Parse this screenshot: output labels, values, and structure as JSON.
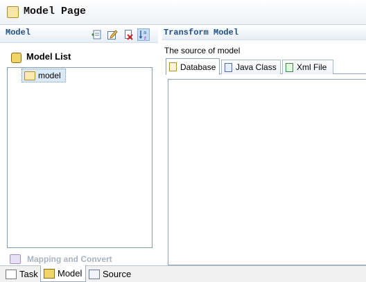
{
  "window": {
    "title": "Model Page",
    "title_icon": "model-page-icon"
  },
  "left_panel": {
    "section_title": "Model",
    "toolbar": [
      {
        "name": "add-model-button",
        "icon": "add-icon"
      },
      {
        "name": "edit-model-button",
        "icon": "edit-icon"
      },
      {
        "name": "delete-model-button",
        "icon": "delete-icon"
      },
      {
        "name": "sort-button",
        "icon": "sort-az-icon",
        "active": true
      }
    ],
    "model_list_label": "Model List",
    "tree_items": [
      {
        "label": "model",
        "icon": "folder-icon",
        "selected": true
      }
    ],
    "mapping_label": "Mapping and Convert"
  },
  "right_panel": {
    "section_title": "Transform Model",
    "source_label": "The source of model",
    "tabs": [
      {
        "label": "Database",
        "icon": "database-icon",
        "selected": true
      },
      {
        "label": "Java Class",
        "icon": "java-class-icon",
        "selected": false
      },
      {
        "label": "Xml File",
        "icon": "xml-file-icon",
        "selected": false
      }
    ]
  },
  "bottom_tabs": [
    {
      "label": "Task",
      "icon": "task-icon",
      "selected": false
    },
    {
      "label": "Model",
      "icon": "model-icon",
      "selected": true
    },
    {
      "label": "Source",
      "icon": "source-icon",
      "selected": false
    }
  ],
  "colors": {
    "section_title": "#1d4e87",
    "selection_bg": "#dbeaf9",
    "border": "#7f9db9"
  }
}
